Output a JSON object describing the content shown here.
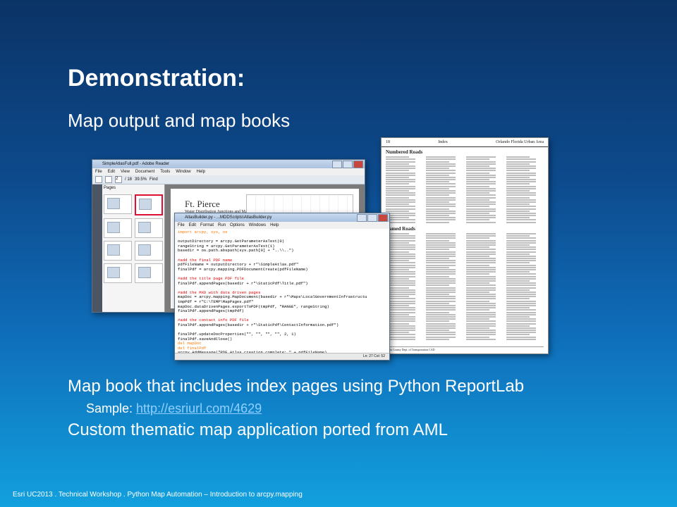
{
  "slide": {
    "title": "Demonstration:",
    "subtitle": "Map output and map books"
  },
  "bullets": {
    "item1": "Map book that includes index pages using Python ReportLab",
    "sample_label": "Sample: ",
    "sample_link": "http://esriurl.com/4629",
    "item2": "Custom thematic map application ported from AML"
  },
  "footer": "Esri UC2013 . Technical Workshop . Python Map Automation – Introduction to arcpy.mapping",
  "reader": {
    "window_title": "SimpleAtlasFull.pdf - Adobe Reader",
    "menu": [
      "File",
      "Edit",
      "View",
      "Document",
      "Tools",
      "Window",
      "Help"
    ],
    "page_box": "2",
    "page_count": "/ 18",
    "zoom": "39.5%",
    "find": "Find",
    "pages_label": "Pages",
    "doc_title": "Ft. Pierce",
    "doc_subtitle": "Water Distribution Junctions and Mains"
  },
  "editor": {
    "window_title": "AtlasBuilder.py - ...MDDScripts\\AtlasBuilder.py",
    "menu": [
      "File",
      "Edit",
      "Format",
      "Run",
      "Options",
      "Windows",
      "Help"
    ],
    "code": [
      {
        "t": "kw",
        "s": "import arcpy, sys, os"
      },
      {
        "t": "",
        "s": ""
      },
      {
        "t": "",
        "s": "outputDirectory = arcpy.GetParameterAsText(0)"
      },
      {
        "t": "",
        "s": "rangeString = arcpy.GetParameterAsText(1)"
      },
      {
        "t": "",
        "s": "basedir = os.path.abspath(sys.path[0] + \"..\\\\..\")"
      },
      {
        "t": "",
        "s": ""
      },
      {
        "t": "cm",
        "s": "#add the final PDF name"
      },
      {
        "t": "",
        "s": "pdfFileName = outputDirectory + r\"\\SimpleAtlas.pdf\""
      },
      {
        "t": "",
        "s": "finalPdf = arcpy.mapping.PDFDocumentCreate(pdfFileName)"
      },
      {
        "t": "",
        "s": ""
      },
      {
        "t": "cm",
        "s": "#add the title page PDF file"
      },
      {
        "t": "",
        "s": "finalPdf.appendPages(basedir + r\"\\StaticPdf\\Title.pdf\")"
      },
      {
        "t": "",
        "s": ""
      },
      {
        "t": "cm",
        "s": "#add the MXD with data driven pages"
      },
      {
        "t": "",
        "s": "mapDoc = arcpy.mapping.MapDocument(basedir + r\"\\Maps\\LocalGovernmentInfrastructu"
      },
      {
        "t": "",
        "s": "tmpPdf = r\"C:\\TEMP\\MapPages.pdf\""
      },
      {
        "t": "",
        "s": "mapDoc.dataDrivenPages.exportToPDF(tmpPdf, \"RANGE\", rangeString)"
      },
      {
        "t": "",
        "s": "finalPdf.appendPages(tmpPdf)"
      },
      {
        "t": "",
        "s": ""
      },
      {
        "t": "cm",
        "s": "#add the contact info PDF file"
      },
      {
        "t": "",
        "s": "finalPdf.appendPages(basedir + r\"\\StaticPdf\\ContactInformation.pdf\")"
      },
      {
        "t": "",
        "s": ""
      },
      {
        "t": "",
        "s": "finalPdf.updateDocProperties(\"\", \"\", \"\", \"\", 2, 1)"
      },
      {
        "t": "",
        "s": "finalPdf.saveAndClose()"
      },
      {
        "t": "kw",
        "s": "del mapDoc"
      },
      {
        "t": "kw",
        "s": "del finalPdf"
      },
      {
        "t": "",
        "s": "arcpy.AddMessage(\"PDF Atlas creation complete: \" + pdfFileName)"
      }
    ],
    "status": "Ln: 27 Col: 52"
  },
  "index_page": {
    "page_number": "18",
    "header_title": "Index",
    "header_right": "Orlando Florida Urban Area",
    "section_numbered": "Numbered Roads",
    "section_named": "Named Roads",
    "footer_text": "Santa County Dept. of Transportation CAD"
  }
}
